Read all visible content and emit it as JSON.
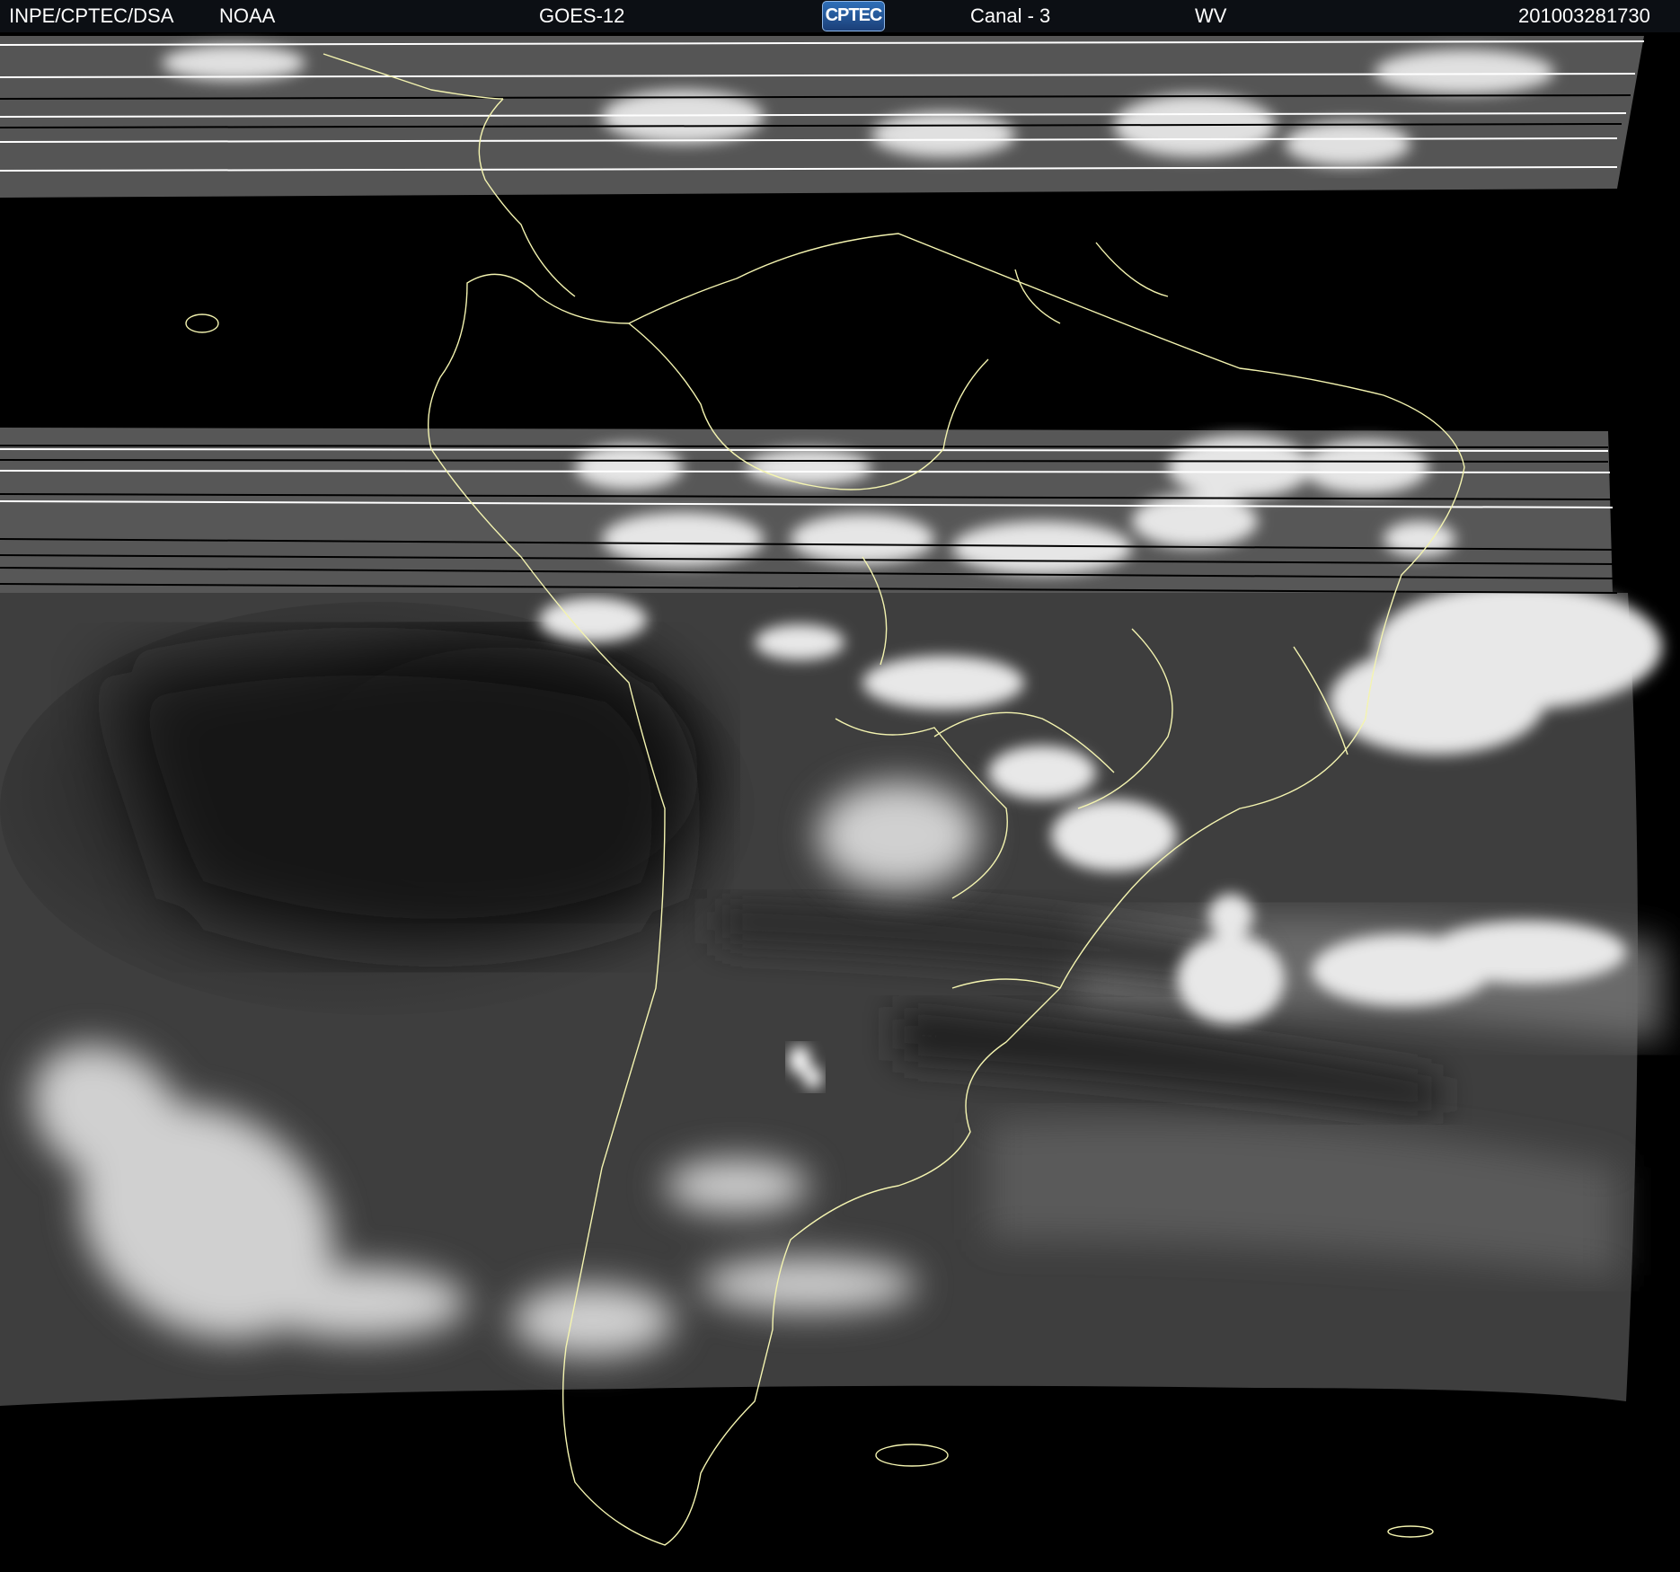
{
  "header": {
    "institution": "INPE/CPTEC/DSA",
    "agency": "NOAA",
    "satellite": "GOES-12",
    "logo_text": "CPTEC",
    "channel": "Canal - 3",
    "band": "WV",
    "timestamp": "201003281730"
  },
  "colors": {
    "header_background": "#0c0f14",
    "coastline": "#f4f4b0",
    "space_background": "#000000"
  }
}
